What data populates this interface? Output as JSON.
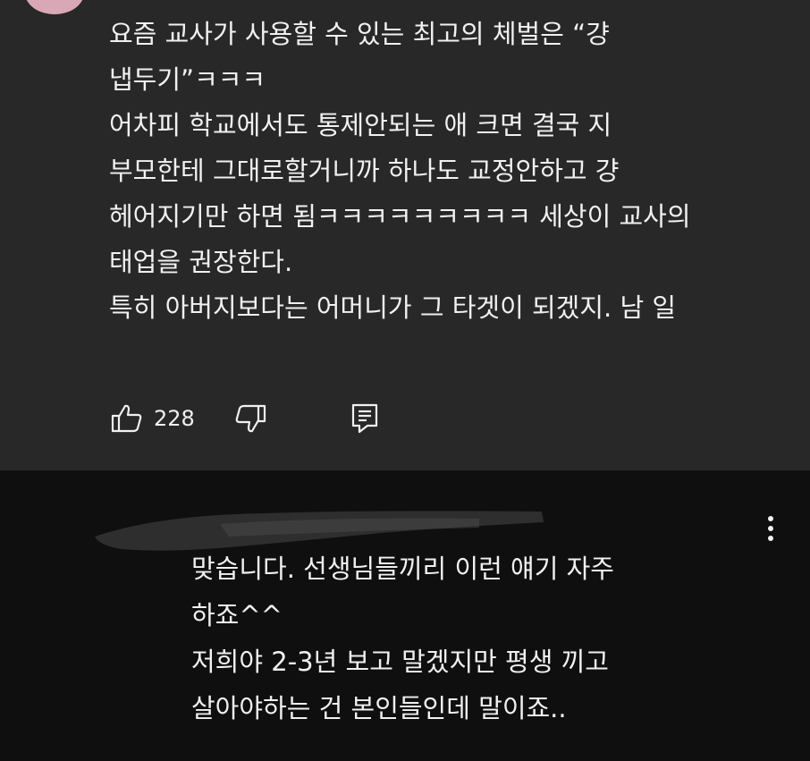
{
  "comment_1": {
    "text_lines": [
      "요즘 교사가 사용할 수 있는 최고의 체벌은 “걍",
      "냅두기”ㅋㅋㅋ",
      "어차피 학교에서도 통제안되는 애 크면 결국 지",
      "부모한테 그대로할거니까 하나도 교정안하고 걍",
      "헤어지기만 하면 됨ㅋㅋㅋㅋㅋㅋㅋㅋㅋ 세상이 교사의",
      "태업을 권장한다.",
      "특히 아버지보다는 어머니가 그 타겟이 되겠지. 남 일"
    ],
    "like_count": "228",
    "icons": {
      "like": "thumbs-up-icon",
      "dislike": "thumbs-down-icon",
      "reply": "reply-comment-icon"
    }
  },
  "comment_2": {
    "text_lines": [
      "맞습니다. 선생님들끼리 이런 얘기 자주",
      "하죠^^",
      "저희야 2-3년 보고 말겠지만 평생 끼고",
      "살아야하는 건 본인들인데 말이죠.."
    ],
    "icons": {
      "more": "more-vertical-icon"
    }
  },
  "colors": {
    "comment_1_background": "#282828",
    "comment_2_background": "#0f0f0f",
    "text": "#f1f1f1"
  }
}
